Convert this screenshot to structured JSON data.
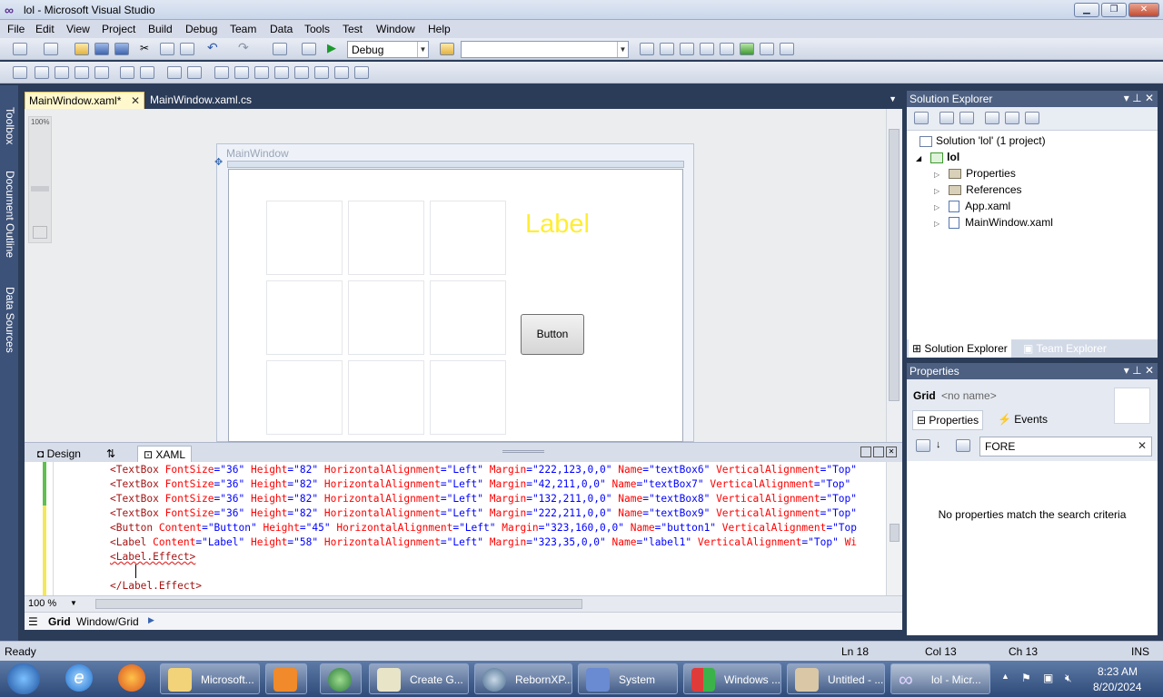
{
  "window": {
    "title": "lol - Microsoft Visual Studio",
    "logo_icon": "infinity-icon"
  },
  "menu": [
    "File",
    "Edit",
    "View",
    "Project",
    "Build",
    "Debug",
    "Team",
    "Data",
    "Tools",
    "Test",
    "Window",
    "Help"
  ],
  "toolbar": {
    "config": "Debug",
    "platform": ""
  },
  "left_rail": [
    "Toolbox",
    "Document Outline",
    "Data Sources"
  ],
  "doc_tabs": [
    {
      "label": "MainWindow.xaml*"
    },
    {
      "label": "MainWindow.xaml.cs"
    }
  ],
  "designer": {
    "zoom_label": "100%",
    "window_title": "MainWindow",
    "label_text": "Label",
    "button_text": "Button",
    "label_color": "#ffee33"
  },
  "split_tabs": {
    "design": "Design",
    "swap": "⇅",
    "xaml": "XAML"
  },
  "xaml_lines": [
    {
      "tag": "<TextBox",
      "attrs": [
        [
          "FontSize",
          "\"36\""
        ],
        [
          "Height",
          "\"82\""
        ],
        [
          "HorizontalAlignment",
          "\"Left\""
        ],
        [
          "Margin",
          "\"222,123,0,0\""
        ],
        [
          "Name",
          "\"textBox6\""
        ],
        [
          "VerticalAlignment",
          "\"Top\""
        ]
      ]
    },
    {
      "tag": "<TextBox",
      "attrs": [
        [
          "FontSize",
          "\"36\""
        ],
        [
          "Height",
          "\"82\""
        ],
        [
          "HorizontalAlignment",
          "\"Left\""
        ],
        [
          "Margin",
          "\"42,211,0,0\""
        ],
        [
          "Name",
          "\"textBox7\""
        ],
        [
          "VerticalAlignment",
          "\"Top\""
        ]
      ]
    },
    {
      "tag": "<TextBox",
      "attrs": [
        [
          "FontSize",
          "\"36\""
        ],
        [
          "Height",
          "\"82\""
        ],
        [
          "HorizontalAlignment",
          "\"Left\""
        ],
        [
          "Margin",
          "\"132,211,0,0\""
        ],
        [
          "Name",
          "\"textBox8\""
        ],
        [
          "VerticalAlignment",
          "\"Top\""
        ]
      ]
    },
    {
      "tag": "<TextBox",
      "attrs": [
        [
          "FontSize",
          "\"36\""
        ],
        [
          "Height",
          "\"82\""
        ],
        [
          "HorizontalAlignment",
          "\"Left\""
        ],
        [
          "Margin",
          "\"222,211,0,0\""
        ],
        [
          "Name",
          "\"textBox9\""
        ],
        [
          "VerticalAlignment",
          "\"Top\""
        ]
      ]
    },
    {
      "tag": "<Button",
      "attrs": [
        [
          "Content",
          "\"Button\""
        ],
        [
          "Height",
          "\"45\""
        ],
        [
          "HorizontalAlignment",
          "\"Left\""
        ],
        [
          "Margin",
          "\"323,160,0,0\""
        ],
        [
          "Name",
          "\"button1\""
        ],
        [
          "VerticalAlignment",
          "\"Top"
        ]
      ]
    },
    {
      "tag": "<Label",
      "attrs": [
        [
          "Content",
          "\"Label\""
        ],
        [
          "Height",
          "\"58\""
        ],
        [
          "HorizontalAlignment",
          "\"Left\""
        ],
        [
          "Margin",
          "\"323,35,0,0\""
        ],
        [
          "Name",
          "\"label1\""
        ],
        [
          "VerticalAlignment",
          "\"Top\""
        ],
        [
          "Wi",
          ""
        ]
      ]
    }
  ],
  "xaml_open": "<Label.Effect>",
  "xaml_close": "</Label.Effect>",
  "editor_zoom": "100 %",
  "breadcrumb": {
    "item": "Grid",
    "path": "Window/Grid"
  },
  "solution_explorer": {
    "title": "Solution Explorer",
    "solution": "Solution 'lol' (1 project)",
    "project": "lol",
    "items": [
      "Properties",
      "References",
      "App.xaml",
      "MainWindow.xaml"
    ],
    "tabs": [
      "Solution Explorer",
      "Team Explorer"
    ]
  },
  "properties": {
    "title": "Properties",
    "object": "Grid",
    "name": "<no name>",
    "tab_properties": "Properties",
    "tab_events": "Events",
    "search": "FORE",
    "empty_msg": "No properties match the search criteria"
  },
  "status": {
    "ready": "Ready",
    "ln": "Ln 18",
    "col": "Col 13",
    "ch": "Ch 13",
    "ins": "INS"
  },
  "taskbar": {
    "tasks": [
      "Microsoft...",
      "",
      "",
      "Create G...",
      "RebornXP...",
      "System",
      "Windows ...",
      "Untitled - ...",
      "lol - Micr..."
    ],
    "time": "8:23 AM",
    "date": "8/20/2024"
  }
}
